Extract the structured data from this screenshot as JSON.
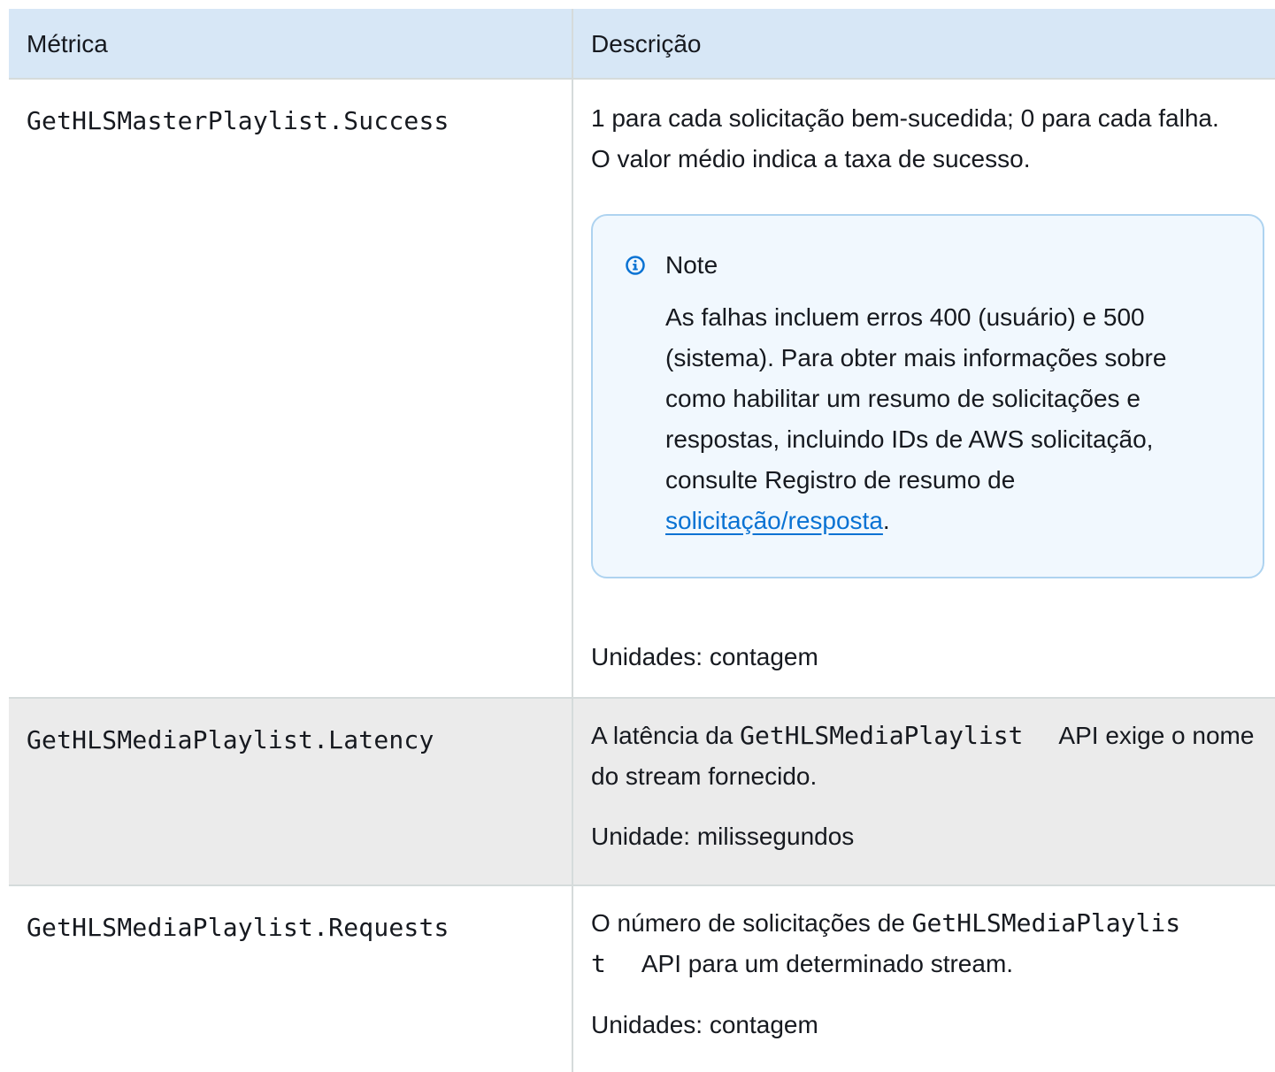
{
  "table": {
    "headers": {
      "metric": "Métrica",
      "description": "Descrição"
    },
    "rows": [
      {
        "metric": "GetHLSMasterPlaylist.Success",
        "description": "1 para cada solicitação bem-sucedida; 0 para cada falha. O valor médio indica a taxa de sucesso.",
        "note": {
          "title": "Note",
          "body_prefix": "As falhas incluem erros 400 (usuário) e 500 (sistema). Para obter mais informações sobre como habilitar um resumo de solicitações e respostas, incluindo IDs de AWS solicitação, consulte Registro de resumo de ",
          "link_text": "solicitação/resposta",
          "body_suffix": "."
        },
        "units": "Unidades: contagem"
      },
      {
        "metric": "GetHLSMediaPlaylist.Latency",
        "description_prefix": "A latência da ",
        "description_code": "GetHLSMediaPlaylist",
        "description_suffix": "API exige o nome do stream fornecido.",
        "units": "Unidade: milissegundos"
      },
      {
        "metric": "GetHLSMediaPlaylist.Requests",
        "description_prefix": "O número de solicitações de ",
        "description_code": "GetHLSMediaPlaylist",
        "description_suffix": "API para um determinado stream.",
        "units": "Unidades: contagem"
      }
    ]
  },
  "colors": {
    "header_bg": "#d7e7f6",
    "note_bg": "#f1f8fe",
    "note_border": "#aed3f0",
    "link": "#0972d3",
    "shaded_row_bg": "#ebebeb",
    "info_icon": "#0972d3"
  },
  "icons": {
    "note": "info-circle-icon"
  }
}
